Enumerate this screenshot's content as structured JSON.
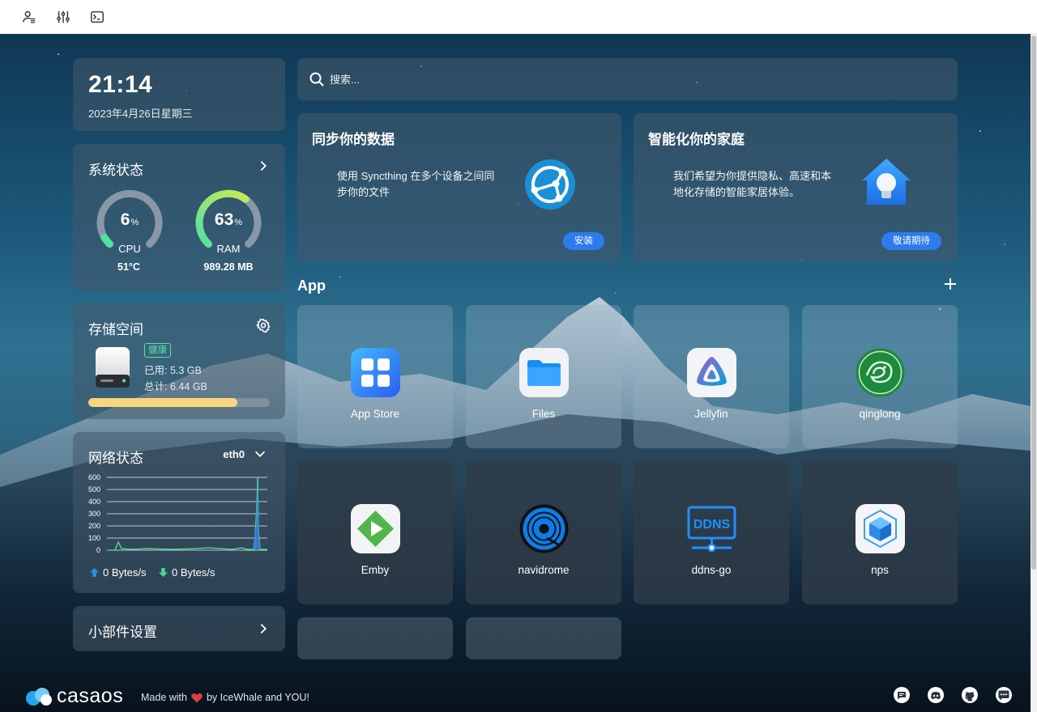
{
  "toolbar": {
    "icons": [
      "user-settings-icon",
      "sliders-icon",
      "terminal-icon"
    ]
  },
  "clock": {
    "time": "21:14",
    "date": "2023年4月26日星期三"
  },
  "system_status": {
    "title": "系统状态",
    "cpu": {
      "value": "6",
      "unit": "%",
      "label": "CPU",
      "sub": "51°C",
      "fraction": 0.06
    },
    "ram": {
      "value": "63",
      "unit": "%",
      "label": "RAM",
      "sub": "989.28 MB",
      "fraction": 0.63
    }
  },
  "storage": {
    "title": "存储空间",
    "badge": "健康",
    "used": "已用: 5.3 GB",
    "total": "总计: 6.44 GB",
    "fraction": 0.82
  },
  "network": {
    "title": "网络状态",
    "interface": "eth0",
    "y_ticks": [
      "600",
      "500",
      "400",
      "300",
      "200",
      "100",
      "0"
    ],
    "upload": "0 Bytes/s",
    "download": "0 Bytes/s"
  },
  "widget_settings": {
    "title": "小部件设置"
  },
  "search": {
    "placeholder": "搜索..."
  },
  "promos": [
    {
      "title": "同步你的数据",
      "desc": "使用 Syncthing 在多个设备之间同步你的文件",
      "button": "安装"
    },
    {
      "title": "智能化你的家庭",
      "desc": "我们希望为你提供隐私、高速和本地化存储的智能家居体验。",
      "button": "敬请期待"
    }
  ],
  "apps_section": {
    "title": "App"
  },
  "apps": [
    {
      "name": "App Store",
      "icon": "app-store-icon"
    },
    {
      "name": "Files",
      "icon": "files-icon"
    },
    {
      "name": "Jellyfin",
      "icon": "jellyfin-icon"
    },
    {
      "name": "qinglong",
      "icon": "qinglong-icon"
    },
    {
      "name": "Emby",
      "icon": "emby-icon"
    },
    {
      "name": "navidrome",
      "icon": "navidrome-icon"
    },
    {
      "name": "ddns-go",
      "icon": "ddns-go-icon",
      "icon_text": "DDNS"
    },
    {
      "name": "nps",
      "icon": "nps-icon"
    }
  ],
  "footer": {
    "logo": "casaos",
    "made_prefix": "Made with",
    "made_suffix": "by IceWhale and YOU!",
    "icons": [
      "feedback-icon",
      "discord-icon",
      "github-icon",
      "chat-icon"
    ]
  },
  "colors": {
    "accent": "#2c7bef",
    "gauge_cpu": "#4fe3a0",
    "gauge_ram": "#c8e64a",
    "storage_bar": "#f7d67d",
    "healthy": "#52e3a8"
  }
}
